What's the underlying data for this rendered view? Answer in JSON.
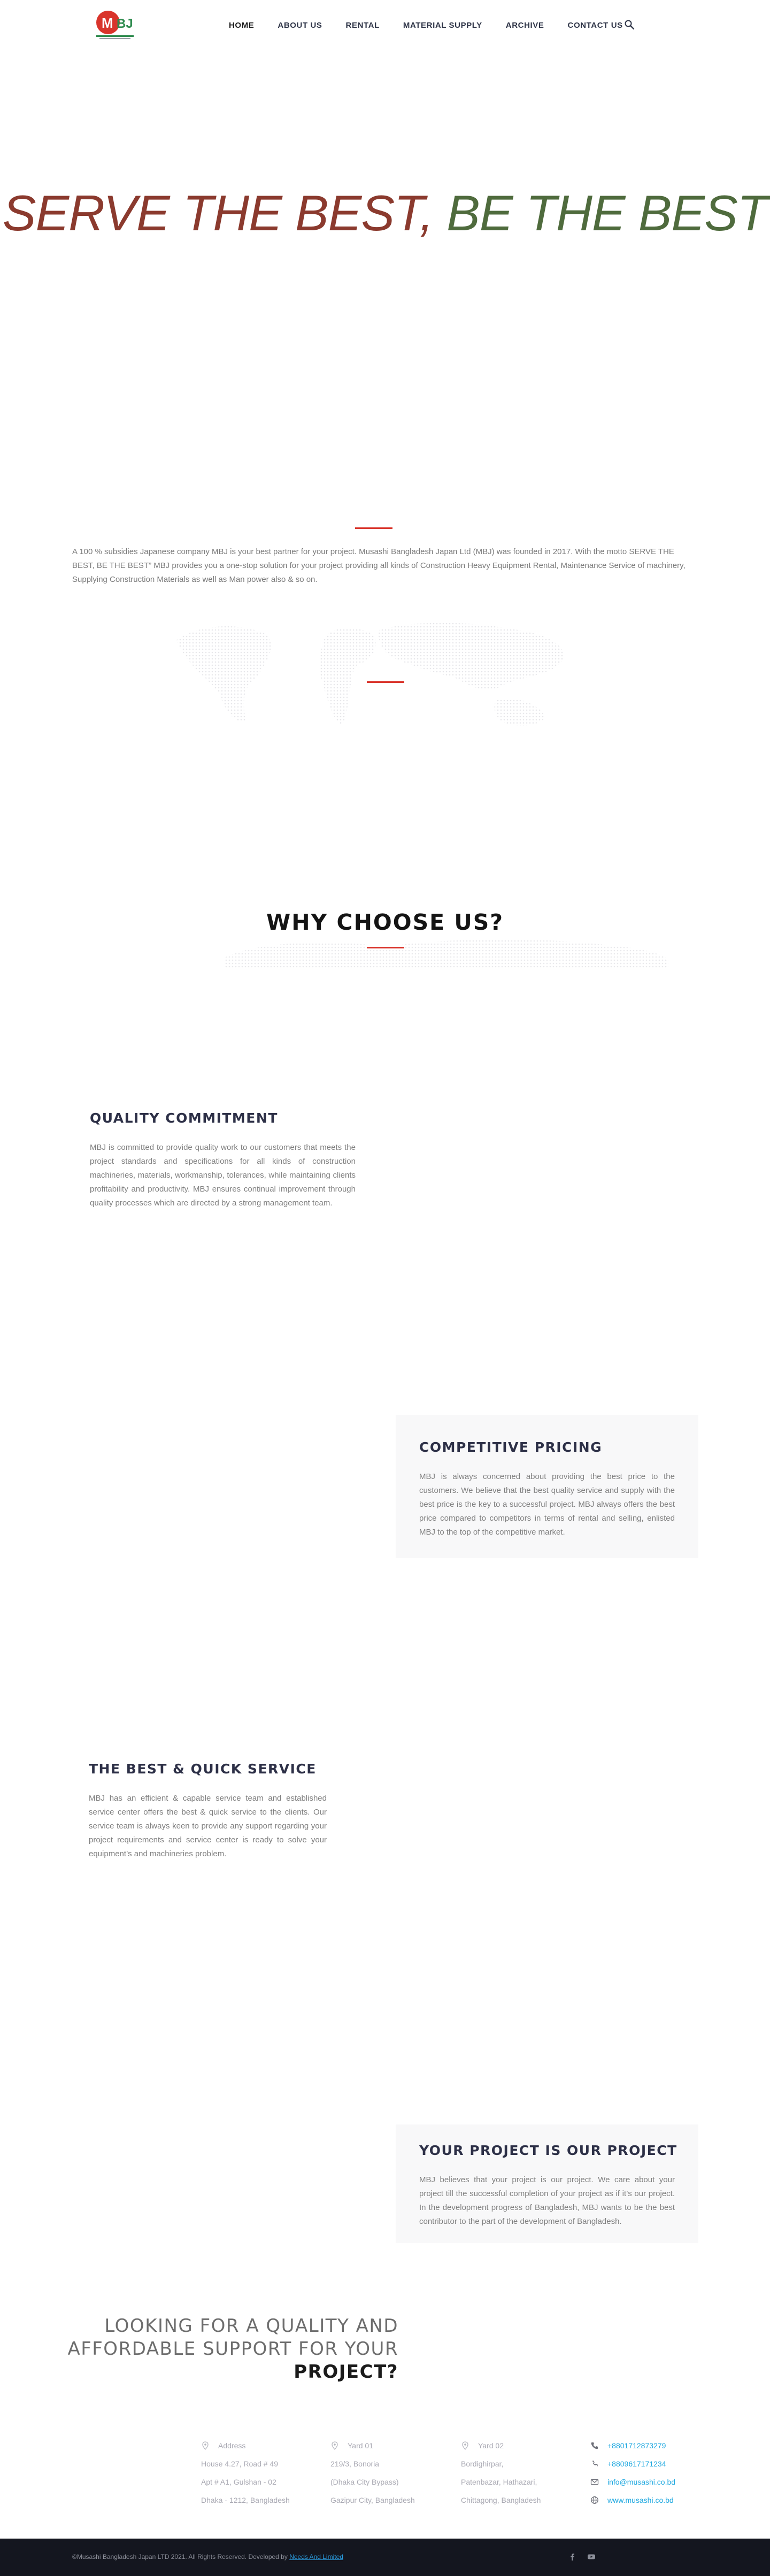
{
  "brand": {
    "logo_text": "MBJ",
    "logo_tagline": "MUSASHI BANGLADESH JAPAN",
    "colors": {
      "red": "#d9342b",
      "green": "#2e8b4e",
      "nav_text": "#2e3447",
      "link": "#1ea8e0"
    }
  },
  "nav": {
    "items": [
      {
        "label": "HOME",
        "active": true
      },
      {
        "label": "ABOUT US",
        "active": false
      },
      {
        "label": "RENTAL",
        "active": false
      },
      {
        "label": "MATERIAL SUPPLY",
        "active": false
      },
      {
        "label": "ARCHIVE",
        "active": false
      },
      {
        "label": "CONTACT US",
        "active": false
      }
    ],
    "search_icon": "search-icon"
  },
  "hero": {
    "title_part1": "SERVE THE BEST,",
    "title_part2": " BE THE BEST"
  },
  "intro": {
    "text": "A 100 % subsidies Japanese company MBJ is your best partner for your project. Musashi Bangladesh Japan Ltd (MBJ) was founded in 2017. With the motto SERVE THE BEST, BE THE BEST” MBJ provides you a one-stop solution for your project providing all kinds of Construction Heavy Equipment Rental, Maintenance Service of machinery, Supplying Construction Materials as well as Man power also & so on."
  },
  "why": {
    "title": "WHY CHOOSE US?"
  },
  "features": [
    {
      "title": "QUALITY COMMITMENT",
      "text": "MBJ is committed to provide quality work to our customers that meets the project standards and specifications for all kinds of construction machineries, materials, workmanship, tolerances, while maintaining clients profitability and productivity. MBJ ensures continual improvement through quality processes which are directed by a strong management team."
    },
    {
      "title": "COMPETITIVE PRICING",
      "text": "MBJ is always concerned about providing the best price to the customers. We believe that the best quality service and supply with the best price is the key to a successful project. MBJ always offers the best price compared to competitors in terms of rental and selling, enlisted MBJ to the top of the competitive market."
    },
    {
      "title": "THE BEST & QUICK SERVICE",
      "text": "MBJ has an efficient & capable service team and established service center offers the best & quick service to the clients. Our service team is always keen to provide any support regarding your project requirements and service center is ready to solve your equipment’s and machineries problem."
    },
    {
      "title": "YOUR PROJECT IS OUR PROJECT",
      "text": "MBJ believes that your project is our project. We care about your project till the successful completion of your project as if it’s our project. In the development progress of Bangladesh, MBJ wants to be the best contributor to the part of the development of Bangladesh."
    }
  ],
  "cta": {
    "line1": "LOOKING FOR A QUALITY AND",
    "line2": "AFFORDABLE SUPPORT FOR YOUR",
    "line3": "PROJECT?"
  },
  "contact": {
    "address": {
      "label": "Address",
      "lines": [
        "House 4.27, Road # 49",
        "Apt # A1, Gulshan - 02",
        "Dhaka - 1212, Bangladesh"
      ]
    },
    "yard1": {
      "label": "Yard 01",
      "lines": [
        "219/3, Bonoria",
        "(Dhaka City Bypass)",
        "Gazipur City, Bangladesh"
      ]
    },
    "yard2": {
      "label": "Yard 02",
      "lines": [
        "Bordighirpar,",
        "Patenbazar, Hathazari,",
        "Chittagong, Bangladesh"
      ]
    },
    "direct": {
      "phone": "+8801712873279",
      "mobile": "+8809617171234",
      "email": "info@musashi.co.bd",
      "web": "www.musashi.co.bd"
    }
  },
  "footer": {
    "copyright": "©Musashi Bangladesh Japan LTD 2021. All Rights Reserved. Developed by ",
    "developer": "Needs And Limited",
    "social": [
      "facebook-icon",
      "youtube-icon"
    ]
  }
}
